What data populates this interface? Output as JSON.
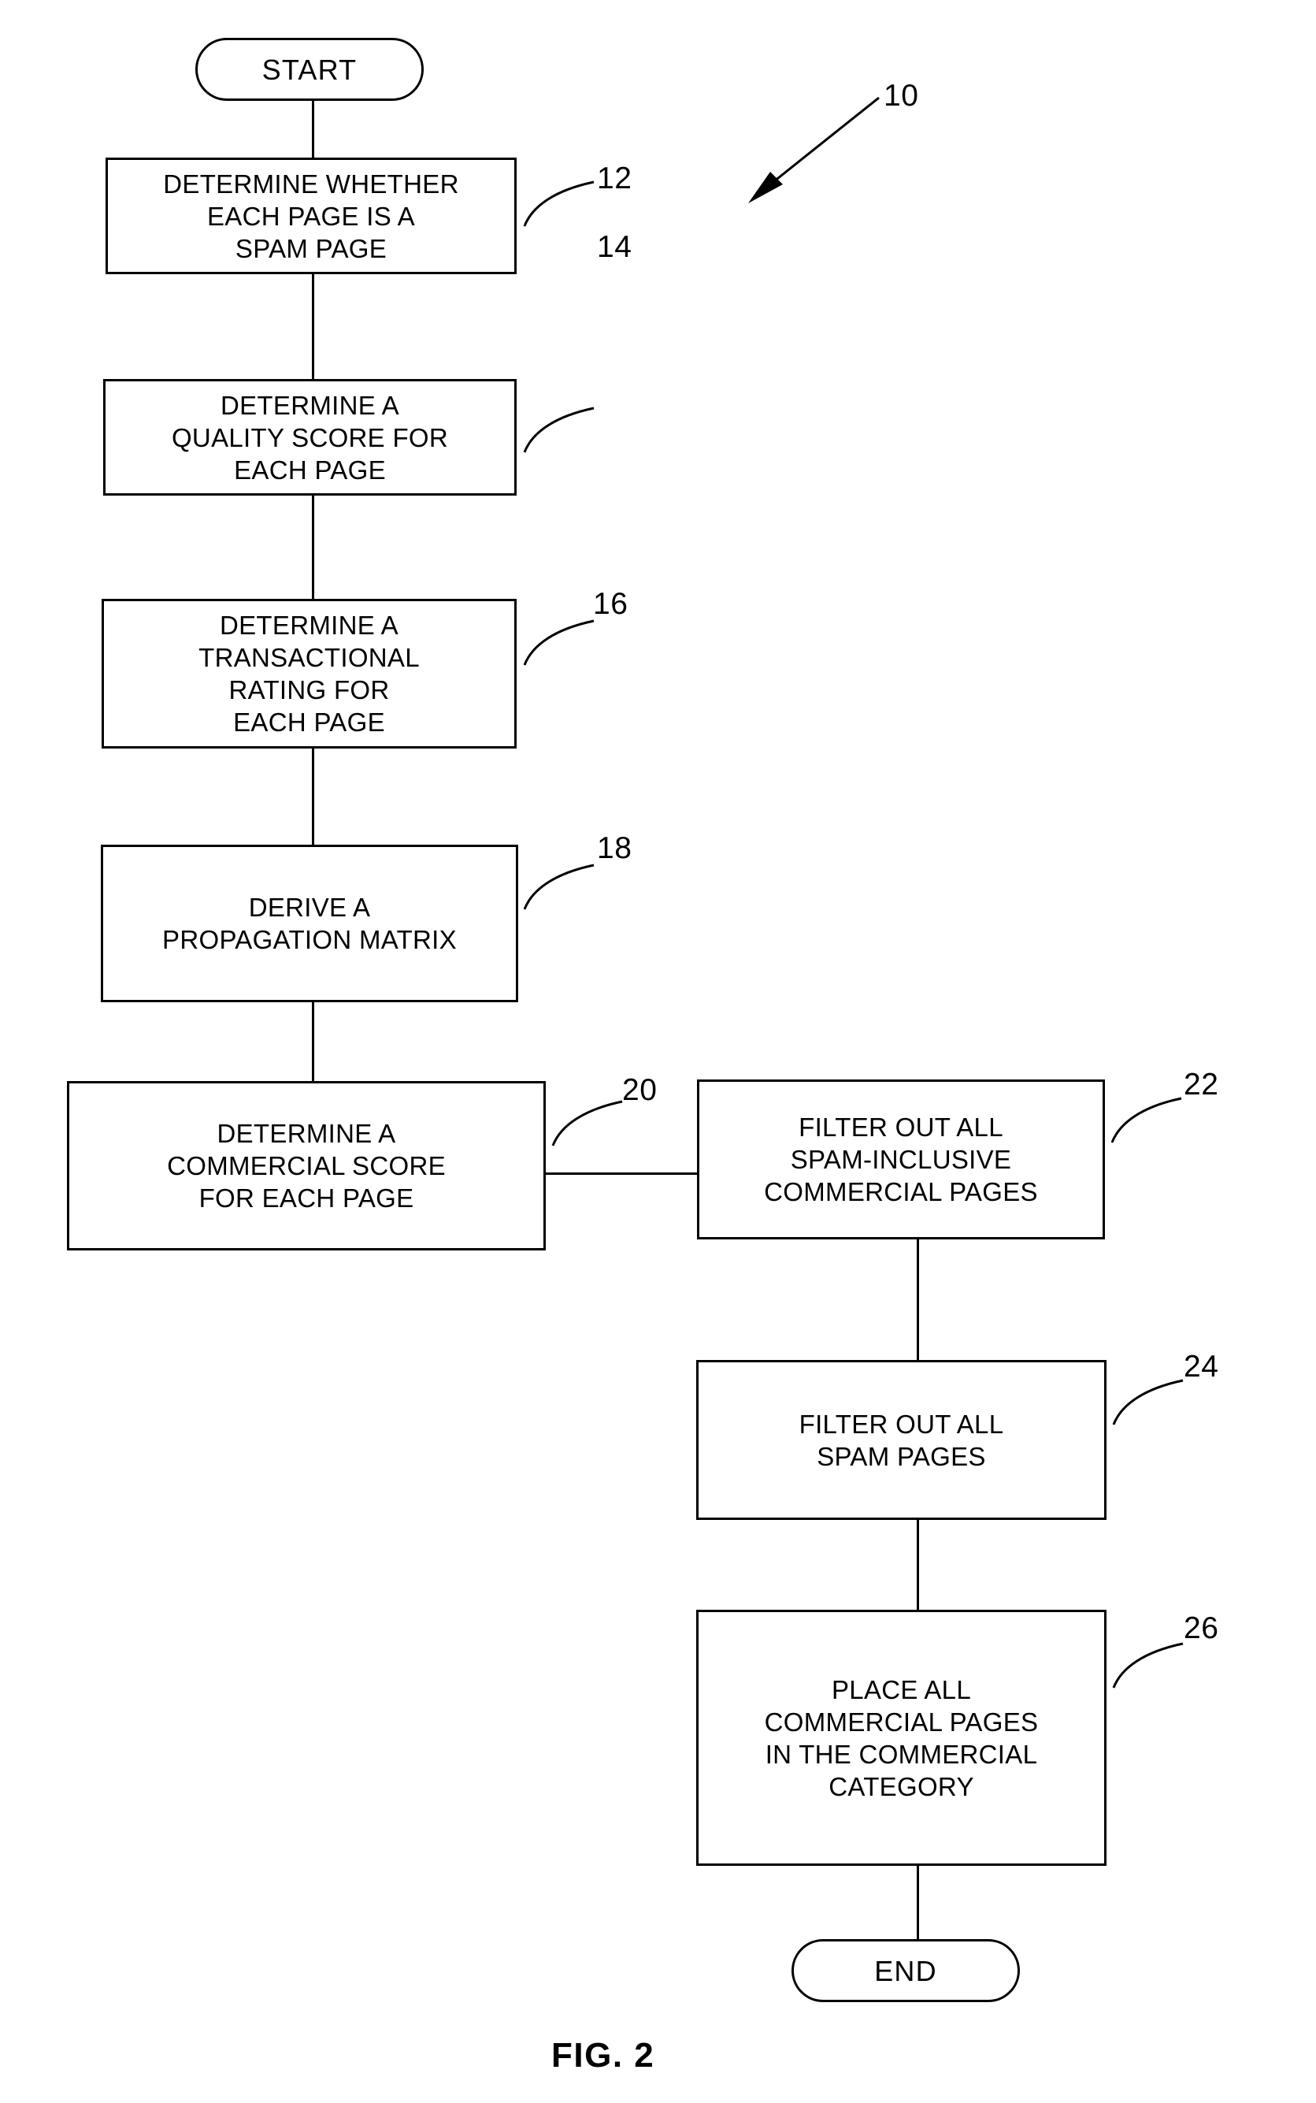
{
  "figure": {
    "caption": "FIG. 2",
    "diagram_ref": "10"
  },
  "nodes": {
    "start": {
      "label": "START",
      "ref": ""
    },
    "step12": {
      "label": "DETERMINE WHETHER\nEACH PAGE IS A\nSPAM PAGE",
      "ref": "12"
    },
    "step14": {
      "label": "DETERMINE A\nQUALITY SCORE FOR\nEACH PAGE",
      "ref": "14"
    },
    "step16": {
      "label": "DETERMINE A\nTRANSACTIONAL\nRATING FOR\nEACH  PAGE",
      "ref": "16"
    },
    "step18": {
      "label": "DERIVE A\nPROPAGATION MATRIX",
      "ref": "18"
    },
    "step20": {
      "label": "DETERMINE A\nCOMMERCIAL SCORE\nFOR EACH PAGE",
      "ref": "20"
    },
    "step22": {
      "label": "FILTER OUT ALL\nSPAM-INCLUSIVE\nCOMMERCIAL PAGES",
      "ref": "22"
    },
    "step24": {
      "label": "FILTER OUT ALL\nSPAM PAGES",
      "ref": "24"
    },
    "step26": {
      "label": "PLACE ALL\nCOMMERCIAL PAGES\nIN THE COMMERCIAL\nCATEGORY",
      "ref": "26"
    },
    "end": {
      "label": "END",
      "ref": ""
    }
  },
  "colors": {
    "ink": "#000000",
    "paper": "#ffffff"
  }
}
